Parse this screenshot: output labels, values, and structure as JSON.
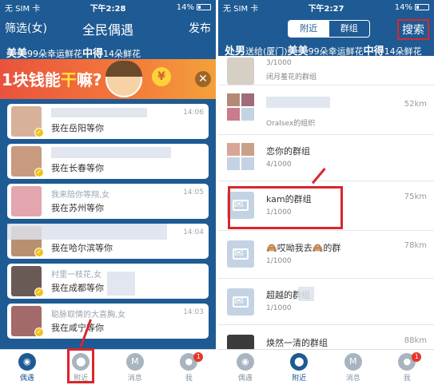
{
  "left": {
    "status": {
      "carrier": "无 SIM 卡",
      "time": "下午2:28",
      "battery": "14%"
    },
    "nav": {
      "left": "筛选(女)",
      "title": "全民偶遇",
      "right": "发布"
    },
    "ticker": {
      "name": "美美",
      "mid": "99朵幸运鲜花",
      "highlight": "中得",
      "tail": "14朵鲜花"
    },
    "banner": {
      "pre": "1块钱能",
      "hl": "干",
      "post": "嘛?",
      "close": "✕"
    },
    "cards": [
      {
        "name": "",
        "msg": "我在岳阳等你",
        "time": "14:06",
        "color": "#d8b19a"
      },
      {
        "name": "",
        "msg": "我在长春等你",
        "time": "",
        "color": "#c89a80"
      },
      {
        "name": "我来陪你等翔,女",
        "msg": "我在苏州等你",
        "time": "14:05",
        "color": "#e3a6ae"
      },
      {
        "name": "",
        "msg": "我在哈尔滨等你",
        "time": "14:04",
        "color": "#b89070"
      },
      {
        "name": "村里一枝花,女",
        "msg": "我在成都等你",
        "time": "",
        "color": "#6a5a55"
      },
      {
        "name": "聪脉取情的大喜胸,女",
        "msg": "我在咸宁等你",
        "time": "14:03",
        "color": "#a26a6a"
      }
    ],
    "tabs": [
      {
        "label": "偶遇",
        "icon": "globe-icon",
        "glyph": "◉",
        "active": true,
        "badge": ""
      },
      {
        "label": "附近",
        "icon": "location-pin-icon",
        "glyph": "⬤",
        "active": false,
        "badge": ""
      },
      {
        "label": "消息",
        "icon": "message-icon",
        "glyph": "M",
        "active": false,
        "badge": ""
      },
      {
        "label": "我",
        "icon": "person-icon",
        "glyph": "●",
        "active": false,
        "badge": "1"
      }
    ]
  },
  "right": {
    "status": {
      "carrier": "无 SIM 卡",
      "time": "下午2:27",
      "battery": "14%"
    },
    "segments": {
      "nearby": "附近",
      "group": "群组"
    },
    "search": "搜索",
    "ticker": {
      "pre": "处男",
      "mid": "送给(厦门)",
      "name": "美美",
      "gift": "99朵幸运鲜花",
      "highlight": "中得",
      "tail": "14朵鲜花"
    },
    "groups": [
      {
        "name": "",
        "count": "3/1000",
        "desc": "闭月羞花的群组",
        "distance": ""
      },
      {
        "name": "",
        "count": "",
        "desc": "Oralsex的组织",
        "distance": "52km"
      },
      {
        "name": "恋你的群组",
        "count": "4/1000",
        "desc": "",
        "distance": ""
      },
      {
        "name": "kam的群组",
        "count": "1/1000",
        "desc": "",
        "distance": "75km"
      },
      {
        "name": "🙈哎呦我去🙈的群",
        "count": "1/1000",
        "desc": "",
        "distance": "78km"
      },
      {
        "name": "超越的群组",
        "count": "1/1000",
        "desc": "",
        "distance": ""
      },
      {
        "name": "焕然一清的群组",
        "count": "",
        "desc": "",
        "distance": "88km"
      }
    ],
    "tabs": [
      {
        "label": "偶遇",
        "icon": "globe-icon",
        "glyph": "◉",
        "active": false,
        "badge": ""
      },
      {
        "label": "附近",
        "icon": "location-pin-icon",
        "glyph": "⬤",
        "active": true,
        "badge": ""
      },
      {
        "label": "消息",
        "icon": "message-icon",
        "glyph": "M",
        "active": false,
        "badge": ""
      },
      {
        "label": "我",
        "icon": "person-icon",
        "glyph": "●",
        "active": false,
        "badge": "1"
      }
    ]
  },
  "colors": {
    "brand": "#1e5a93",
    "highlight_red": "#d9262c",
    "banner_orange": "#f47a3a"
  }
}
